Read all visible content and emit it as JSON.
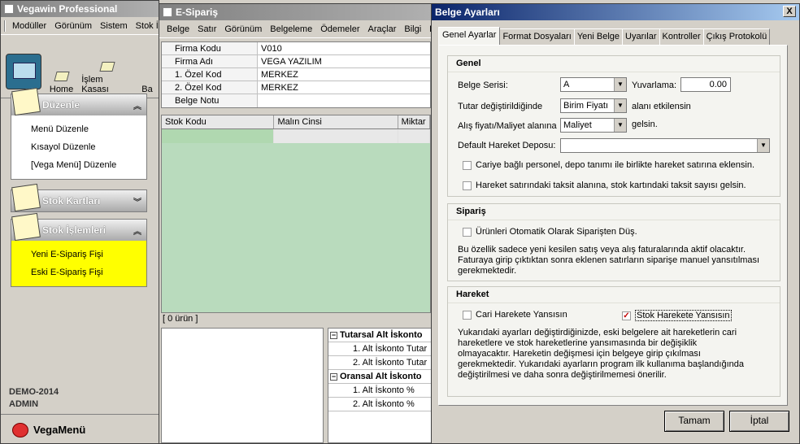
{
  "left": {
    "title": "Vegawin Professional",
    "menu": [
      "Modüller",
      "Görünüm",
      "Sistem",
      "Stok İ"
    ],
    "toolbar": {
      "home": "Home",
      "kasa": "İşlem Kasası",
      "partial": "Ba"
    },
    "panels": [
      {
        "title": "Düzenle",
        "items": [
          "Menü Düzenle",
          "Kısayol Düzenle",
          "[Vega Menü] Düzenle"
        ]
      },
      {
        "title": "Stok Kartları",
        "items": []
      },
      {
        "title": "Stok İşlemleri",
        "items": [
          "Yeni E-Sipariş Fişi",
          "Eski E-Sipariş Fişi"
        ]
      }
    ],
    "footer": {
      "db": "DEMO-2014",
      "user": "ADMIN",
      "vegamenu": "VegaMenü"
    }
  },
  "mid": {
    "title": "E-Sipariş",
    "menu": [
      "Belge",
      "Satır",
      "Görünüm",
      "Belgeleme",
      "Ödemeler",
      "Araçlar",
      "Bilgi",
      "E"
    ],
    "form": [
      {
        "label": "Firma Kodu",
        "value": "V010"
      },
      {
        "label": "Firma Adı",
        "value": "VEGA YAZILIM"
      },
      {
        "label": "1. Özel Kod",
        "value": "MERKEZ"
      },
      {
        "label": "2. Özel Kod",
        "value": "MERKEZ"
      },
      {
        "label": "Belge Notu",
        "value": ""
      }
    ],
    "grid_headers": [
      "Stok Kodu",
      "Malın Cinsi",
      "Miktar"
    ],
    "count": "[ 0 ürün ]",
    "discount": {
      "group1": "Tutarsal Alt İskonto",
      "items1": [
        "1. Alt İskonto Tutar",
        "2. Alt İskonto Tutar"
      ],
      "group2": "Oransal Alt İskonto",
      "items2": [
        "1. Alt İskonto %",
        "2. Alt İskonto %"
      ]
    }
  },
  "dialog": {
    "title": "Belge Ayarları",
    "close": "X",
    "tabs": [
      "Genel Ayarlar",
      "Format Dosyaları",
      "Yeni Belge",
      "Uyarılar",
      "Kontroller",
      "Çıkış Protokolü"
    ],
    "genel": {
      "title": "Genel",
      "belge_serisi_label": "Belge Serisi:",
      "belge_serisi_value": "A",
      "yuvarlama_label": "Yuvarlama:",
      "yuvarlama_value": "0.00",
      "tutar_label": "Tutar değiştirildiğinde",
      "tutar_value": "Birim Fiyatı",
      "tutar_suffix": "alanı etkilensin",
      "alis_label": "Alış fiyatı/Maliyet alanına",
      "alis_value": "Maliyet",
      "alis_suffix": "gelsin.",
      "depo_label": "Default Hareket Deposu:",
      "depo_value": "",
      "chk1": "Cariye bağlı personel, depo tanımı ile birlikte hareket satırına eklensin.",
      "chk2": "Hareket satırındaki taksit alanına, stok kartındaki taksit sayısı gelsin."
    },
    "siparis": {
      "title": "Sipariş",
      "chk": "Ürünleri Otomatik Olarak Siparişten Düş.",
      "note": "Bu özellik sadece yeni kesilen satış veya alış faturalarında aktif olacaktır. Faturaya girip çıktıktan sonra eklenen satırların siparişe manuel yansıtılması gerekmektedir."
    },
    "hareket": {
      "title": "Hareket",
      "chk_cari": "Cari Harekete Yansısın",
      "chk_stok": "Stok Harekete Yansısın",
      "chk_stok_checked": true,
      "note": "Yukarıdaki ayarları değiştirdiğinizde, eski belgelere ait hareketlerin cari hareketlere ve stok hareketlerine yansımasında bir değişiklik olmayacaktır. Hareketin değişmesi için belgeye girip çıkılması gerekmektedir. Yukarıdaki ayarların program ilk kullanıma başlandığında değiştirilmesi ve daha sonra değiştirilmemesi önerilir."
    },
    "ok": "Tamam",
    "cancel": "İptal"
  }
}
